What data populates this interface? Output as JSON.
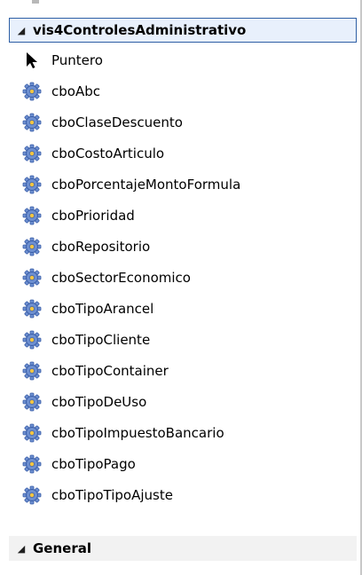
{
  "groups": [
    {
      "label": "vis4ControlesAdministrativo",
      "expander": "◢",
      "selected": true
    },
    {
      "label": "General",
      "expander": "◢",
      "selected": false
    }
  ],
  "items": [
    {
      "label": "Puntero",
      "icon": "pointer-arrow-icon"
    },
    {
      "label": "cboAbc",
      "icon": "component-gear-icon"
    },
    {
      "label": "cboClaseDescuento",
      "icon": "component-gear-icon"
    },
    {
      "label": "cboCostoArticulo",
      "icon": "component-gear-icon"
    },
    {
      "label": "cboPorcentajeMontoFormula",
      "icon": "component-gear-icon"
    },
    {
      "label": "cboPrioridad",
      "icon": "component-gear-icon"
    },
    {
      "label": "cboRepositorio",
      "icon": "component-gear-icon"
    },
    {
      "label": "cboSectorEconomico",
      "icon": "component-gear-icon"
    },
    {
      "label": "cboTipoArancel",
      "icon": "component-gear-icon"
    },
    {
      "label": "cboTipoCliente",
      "icon": "component-gear-icon"
    },
    {
      "label": "cboTipoContainer",
      "icon": "component-gear-icon"
    },
    {
      "label": "cboTipoDeUso",
      "icon": "component-gear-icon"
    },
    {
      "label": "cboTipoImpuestoBancario",
      "icon": "component-gear-icon"
    },
    {
      "label": "cboTipoPago",
      "icon": "component-gear-icon"
    },
    {
      "label": "cboTipoTipoAjuste",
      "icon": "component-gear-icon"
    }
  ],
  "colors": {
    "selected_background": "#e8f0fc",
    "selected_border": "#2e5fa5",
    "group_background": "#f2f2f2",
    "gear_fill": "#6d8fd0",
    "gear_outline": "#3a5ea8",
    "gear_hub": "#f4c542"
  }
}
